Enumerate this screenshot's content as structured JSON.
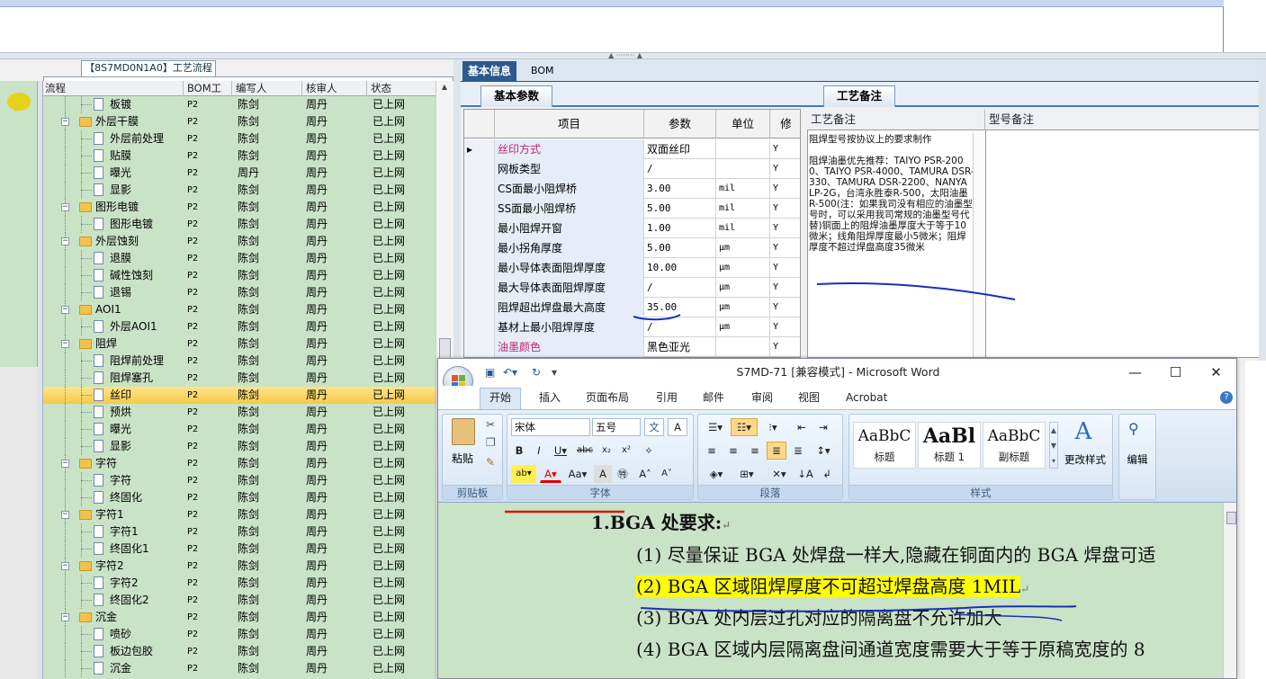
{
  "tree": {
    "title": "【8S7MD0N1A0】工艺流程",
    "columns": [
      "流程",
      "BOM工厂",
      "编写人",
      "核审人",
      "状态"
    ],
    "rows": [
      {
        "name": "板镀",
        "level": 2,
        "type": "doc",
        "factory": "P2",
        "writer": "陈剑",
        "reviewer": "周丹",
        "status": "已上网"
      },
      {
        "name": "外层干膜",
        "level": 1,
        "type": "folder",
        "factory": "P2",
        "writer": "陈剑",
        "reviewer": "周丹",
        "status": "已上网"
      },
      {
        "name": "外层前处理",
        "level": 2,
        "type": "doc",
        "factory": "P2",
        "writer": "陈剑",
        "reviewer": "周丹",
        "status": "已上网"
      },
      {
        "name": "贴膜",
        "level": 2,
        "type": "doc",
        "factory": "P2",
        "writer": "陈剑",
        "reviewer": "周丹",
        "status": "已上网"
      },
      {
        "name": "曝光",
        "level": 2,
        "type": "doc",
        "factory": "P2",
        "writer": "周丹",
        "reviewer": "周丹",
        "status": "已上网"
      },
      {
        "name": "显影",
        "level": 2,
        "type": "doc",
        "factory": "P2",
        "writer": "陈剑",
        "reviewer": "周丹",
        "status": "已上网"
      },
      {
        "name": "图形电镀",
        "level": 1,
        "type": "folder",
        "factory": "P2",
        "writer": "陈剑",
        "reviewer": "周丹",
        "status": "已上网"
      },
      {
        "name": "图形电镀",
        "level": 2,
        "type": "doc",
        "factory": "P2",
        "writer": "陈剑",
        "reviewer": "周丹",
        "status": "已上网"
      },
      {
        "name": "外层蚀刻",
        "level": 1,
        "type": "folder",
        "factory": "P2",
        "writer": "陈剑",
        "reviewer": "周丹",
        "status": "已上网"
      },
      {
        "name": "退膜",
        "level": 2,
        "type": "doc",
        "factory": "P2",
        "writer": "陈剑",
        "reviewer": "周丹",
        "status": "已上网"
      },
      {
        "name": "碱性蚀刻",
        "level": 2,
        "type": "doc",
        "factory": "P2",
        "writer": "陈剑",
        "reviewer": "周丹",
        "status": "已上网"
      },
      {
        "name": "退锡",
        "level": 2,
        "type": "doc",
        "factory": "P2",
        "writer": "陈剑",
        "reviewer": "周丹",
        "status": "已上网"
      },
      {
        "name": "AOI1",
        "level": 1,
        "type": "folder",
        "factory": "P2",
        "writer": "陈剑",
        "reviewer": "周丹",
        "status": "已上网"
      },
      {
        "name": "外层AOI1",
        "level": 2,
        "type": "doc",
        "factory": "P2",
        "writer": "陈剑",
        "reviewer": "周丹",
        "status": "已上网"
      },
      {
        "name": "阻焊",
        "level": 1,
        "type": "folder",
        "factory": "P2",
        "writer": "陈剑",
        "reviewer": "周丹",
        "status": "已上网"
      },
      {
        "name": "阻焊前处理",
        "level": 2,
        "type": "doc",
        "factory": "P2",
        "writer": "陈剑",
        "reviewer": "周丹",
        "status": "已上网"
      },
      {
        "name": "阻焊塞孔",
        "level": 2,
        "type": "doc",
        "factory": "P2",
        "writer": "陈剑",
        "reviewer": "周丹",
        "status": "已上网"
      },
      {
        "name": "丝印",
        "level": 2,
        "type": "doc",
        "factory": "P2",
        "writer": "陈剑",
        "reviewer": "周丹",
        "status": "已上网",
        "selected": true
      },
      {
        "name": "预烘",
        "level": 2,
        "type": "doc",
        "factory": "P2",
        "writer": "陈剑",
        "reviewer": "周丹",
        "status": "已上网"
      },
      {
        "name": "曝光",
        "level": 2,
        "type": "doc",
        "factory": "P2",
        "writer": "陈剑",
        "reviewer": "周丹",
        "status": "已上网"
      },
      {
        "name": "显影",
        "level": 2,
        "type": "doc",
        "factory": "P2",
        "writer": "陈剑",
        "reviewer": "周丹",
        "status": "已上网"
      },
      {
        "name": "字符",
        "level": 1,
        "type": "folder",
        "factory": "P2",
        "writer": "陈剑",
        "reviewer": "周丹",
        "status": "已上网"
      },
      {
        "name": "字符",
        "level": 2,
        "type": "doc",
        "factory": "P2",
        "writer": "陈剑",
        "reviewer": "周丹",
        "status": "已上网"
      },
      {
        "name": "终固化",
        "level": 2,
        "type": "doc",
        "factory": "P2",
        "writer": "陈剑",
        "reviewer": "周丹",
        "status": "已上网"
      },
      {
        "name": "字符1",
        "level": 1,
        "type": "folder",
        "factory": "P2",
        "writer": "陈剑",
        "reviewer": "周丹",
        "status": "已上网"
      },
      {
        "name": "字符1",
        "level": 2,
        "type": "doc",
        "factory": "P2",
        "writer": "陈剑",
        "reviewer": "周丹",
        "status": "已上网"
      },
      {
        "name": "终固化1",
        "level": 2,
        "type": "doc",
        "factory": "P2",
        "writer": "陈剑",
        "reviewer": "周丹",
        "status": "已上网"
      },
      {
        "name": "字符2",
        "level": 1,
        "type": "folder",
        "factory": "P2",
        "writer": "陈剑",
        "reviewer": "周丹",
        "status": "已上网"
      },
      {
        "name": "字符2",
        "level": 2,
        "type": "doc",
        "factory": "P2",
        "writer": "陈剑",
        "reviewer": "周丹",
        "status": "已上网"
      },
      {
        "name": "终固化2",
        "level": 2,
        "type": "doc",
        "factory": "P2",
        "writer": "陈剑",
        "reviewer": "周丹",
        "status": "已上网"
      },
      {
        "name": "沉金",
        "level": 1,
        "type": "folder",
        "factory": "P2",
        "writer": "陈剑",
        "reviewer": "周丹",
        "status": "已上网"
      },
      {
        "name": "喷砂",
        "level": 2,
        "type": "doc",
        "factory": "P2",
        "writer": "陈剑",
        "reviewer": "周丹",
        "status": "已上网"
      },
      {
        "name": "板边包胶",
        "level": 2,
        "type": "doc",
        "factory": "P2",
        "writer": "陈剑",
        "reviewer": "周丹",
        "status": "已上网"
      },
      {
        "name": "沉金",
        "level": 2,
        "type": "doc",
        "factory": "P2",
        "writer": "陈剑",
        "reviewer": "周丹",
        "status": "已上网"
      }
    ]
  },
  "right": {
    "tabs": [
      "基本信息",
      "BOM"
    ],
    "params_tab": "基本参数",
    "notes_tab": "工艺备注",
    "grid_columns": [
      "项目",
      "参数",
      "单位",
      "修"
    ],
    "grid_rows": [
      {
        "item": "丝印方式",
        "value": "双面丝印",
        "unit": "",
        "mod": "Y",
        "pink": true,
        "current": true
      },
      {
        "item": "网板类型",
        "value": "/",
        "unit": "",
        "mod": "Y"
      },
      {
        "item": "CS面最小阻焊桥",
        "value": "3.00",
        "unit": "mil",
        "mod": "Y"
      },
      {
        "item": "SS面最小阻焊桥",
        "value": "5.00",
        "unit": "mil",
        "mod": "Y"
      },
      {
        "item": "最小阻焊开窗",
        "value": "1.00",
        "unit": "mil",
        "mod": "Y"
      },
      {
        "item": "最小拐角厚度",
        "value": "5.00",
        "unit": "μm",
        "mod": "Y"
      },
      {
        "item": "最小导体表面阻焊厚度",
        "value": "10.00",
        "unit": "μm",
        "mod": "Y"
      },
      {
        "item": "最大导体表面阻焊厚度",
        "value": "/",
        "unit": "μm",
        "mod": "Y"
      },
      {
        "item": "阻焊超出焊盘最大高度",
        "value": "35.00",
        "unit": "μm",
        "mod": "Y"
      },
      {
        "item": "基材上最小阻焊厚度",
        "value": "/",
        "unit": "μm",
        "mod": "Y"
      },
      {
        "item": "油墨颜色",
        "value": "黑色亚光",
        "unit": "",
        "mod": "Y",
        "pink": true
      }
    ],
    "notes_columns": [
      "工艺备注",
      "型号备注"
    ],
    "notes_p1": "阻焊型号按协议上的要求制作",
    "notes_p2": "阻焊油墨优先推荐：TAIYO PSR-2000、TAIYO PSR-4000、TAMURA DSR-330、TAMURA DSR-2200、NANYA LP-2G，台湾永胜泰R-500，太阳油墨R-500(注：如果我司没有相应的油墨型号时，可以采用我司常规的油墨型号代替)铜面上的阻焊油墨厚度大于等于10微米；线角阻焊厚度最小5微米；阻焊厚度不超过焊盘高度35微米"
  },
  "word": {
    "title": "S7MD-71 [兼容模式] - Microsoft Word",
    "menu": [
      "开始",
      "插入",
      "页面布局",
      "引用",
      "邮件",
      "审阅",
      "视图",
      "Acrobat"
    ],
    "clipboard": {
      "paste": "粘贴",
      "group": "剪贴板"
    },
    "font": {
      "name": "宋体",
      "size": "五号",
      "group": "字体"
    },
    "paragraph_group": "段落",
    "styles": [
      {
        "preview": "AaBbC",
        "label": "标题"
      },
      {
        "preview": "AaBl",
        "label": "标题 1"
      },
      {
        "preview": "AaBbC",
        "label": "副标题"
      }
    ],
    "styles_group": "样式",
    "change_styles": "更改样式",
    "edit": "编辑",
    "doc": {
      "heading": "1.BGA 处要求:",
      "items": [
        "(1) 尽量保证 BGA 处焊盘一样大,隐藏在铜面内的 BGA 焊盘可适",
        "(2) BGA 区域阻焊厚度不可超过焊盘高度 1MIL",
        "(3) BGA 处内层过孔对应的隔离盘不允许加大",
        "(4) BGA 区域内层隔离盘间通道宽度需要大于等于原稿宽度的 8"
      ]
    }
  },
  "colors": {
    "tree_bg": "#c9e3c7",
    "selected": "#f6c94a",
    "pink": "#c0267a",
    "annot_blue": "#1a2fb8",
    "annot_red": "#e01010",
    "highlight": "#ffff00"
  }
}
